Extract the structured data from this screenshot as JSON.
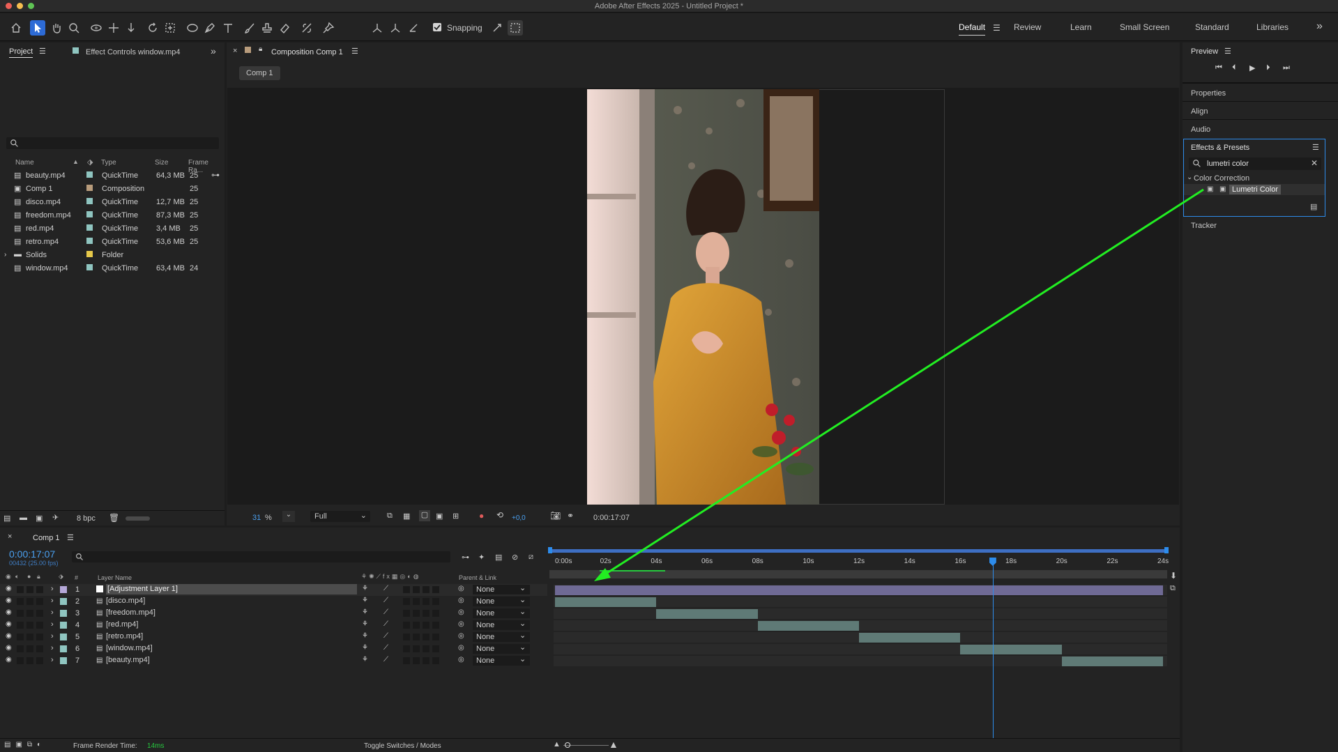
{
  "window": {
    "title": "Adobe After Effects 2025 - Untitled Project *"
  },
  "toolbar": {
    "tools": [
      "home-icon",
      "selection-tool-icon",
      "hand-tool-icon",
      "zoom-tool-icon",
      "orbit-camera-icon",
      "pan-camera-icon",
      "dolly-camera-icon",
      "rotate-tool-icon",
      "pan-behind-icon",
      "ellipse-tool-icon",
      "pen-tool-icon",
      "type-tool-icon",
      "brush-tool-icon",
      "clone-stamp-icon",
      "eraser-tool-icon",
      "roto-brush-icon",
      "puppet-pin-icon"
    ],
    "snapping_label": "Snapping",
    "snapping_checked": true
  },
  "workspaces": {
    "items": [
      "Default",
      "Review",
      "Learn",
      "Small Screen",
      "Standard",
      "Libraries"
    ],
    "active": "Default",
    "more": "»"
  },
  "project_panel": {
    "tab_project": "Project",
    "tab_effect_controls": "Effect Controls window.mp4",
    "search_placeholder": "",
    "columns": {
      "name": "Name",
      "type": "Type",
      "size": "Size",
      "frame_rate": "Frame Ra..."
    },
    "items": [
      {
        "name": "beauty.mp4",
        "type": "QuickTime",
        "size": "64,3 MB",
        "fps": "25",
        "label": "#8fc5c0",
        "icon": "footage"
      },
      {
        "name": "Comp 1",
        "type": "Composition",
        "size": "",
        "fps": "25",
        "label": "#b89c7c",
        "icon": "comp"
      },
      {
        "name": "disco.mp4",
        "type": "QuickTime",
        "size": "12,7 MB",
        "fps": "25",
        "label": "#8fc5c0",
        "icon": "footage"
      },
      {
        "name": "freedom.mp4",
        "type": "QuickTime",
        "size": "87,3 MB",
        "fps": "25",
        "label": "#8fc5c0",
        "icon": "footage"
      },
      {
        "name": "red.mp4",
        "type": "QuickTime",
        "size": "3,4 MB",
        "fps": "25",
        "label": "#8fc5c0",
        "icon": "footage"
      },
      {
        "name": "retro.mp4",
        "type": "QuickTime",
        "size": "53,6 MB",
        "fps": "25",
        "label": "#8fc5c0",
        "icon": "footage"
      },
      {
        "name": "Solids",
        "type": "Folder",
        "size": "",
        "fps": "",
        "label": "#e6c84a",
        "icon": "folder"
      },
      {
        "name": "window.mp4",
        "type": "QuickTime",
        "size": "63,4 MB",
        "fps": "24",
        "label": "#8fc5c0",
        "icon": "footage"
      }
    ],
    "bpc": "8 bpc"
  },
  "comp_viewer": {
    "tab": "Composition Comp 1",
    "breadcrumb": "Comp 1",
    "zoom": "31",
    "zoom_unit": "%",
    "resolution": "Full",
    "exposure": "+0,0",
    "timecode": "0:00:17:07"
  },
  "right_panel": {
    "preview": "Preview",
    "properties": "Properties",
    "align": "Align",
    "audio": "Audio",
    "effects_presets": "Effects & Presets",
    "search_value": "lumetri color",
    "category": "Color Correction",
    "effect": "Lumetri Color",
    "tracker": "Tracker"
  },
  "timeline": {
    "tab": "Comp 1",
    "timecode": "0:00:17:07",
    "frame_info": "00432 (25.00 fps)",
    "columns": {
      "num": "#",
      "layer_name": "Layer Name",
      "parent": "Parent & Link"
    },
    "ruler": [
      "0:00s",
      "02s",
      "04s",
      "06s",
      "08s",
      "10s",
      "12s",
      "14s",
      "16s",
      "18s",
      "20s",
      "22s",
      "24s"
    ],
    "playhead_seconds": 17.28,
    "duration_seconds": 24,
    "layers": [
      {
        "num": "1",
        "name": "[Adjustment Layer 1]",
        "parent": "None",
        "label": "#b5a8d8",
        "start": 0,
        "end": 24,
        "selected": true
      },
      {
        "num": "2",
        "name": "[disco.mp4]",
        "parent": "None",
        "label": "#8fc5c0",
        "start": 0,
        "end": 4
      },
      {
        "num": "3",
        "name": "[freedom.mp4]",
        "parent": "None",
        "label": "#8fc5c0",
        "start": 4,
        "end": 8
      },
      {
        "num": "4",
        "name": "[red.mp4]",
        "parent": "None",
        "label": "#8fc5c0",
        "start": 8,
        "end": 12
      },
      {
        "num": "5",
        "name": "[retro.mp4]",
        "parent": "None",
        "label": "#8fc5c0",
        "start": 12,
        "end": 16
      },
      {
        "num": "6",
        "name": "[window.mp4]",
        "parent": "None",
        "label": "#8fc5c0",
        "start": 16,
        "end": 20
      },
      {
        "num": "7",
        "name": "[beauty.mp4]",
        "parent": "None",
        "label": "#8fc5c0",
        "start": 20,
        "end": 24
      }
    ],
    "footer_render_label": "Frame Render Time:",
    "footer_render_value": "14ms",
    "footer_toggle": "Toggle Switches / Modes"
  },
  "colors": {
    "accent_blue": "#2d8ceb",
    "timecode_blue": "#4aa0f0",
    "annotation_green": "#22ee22",
    "layer_bar": "#5f7a76",
    "adjustment_bar": "#6f6a95"
  }
}
